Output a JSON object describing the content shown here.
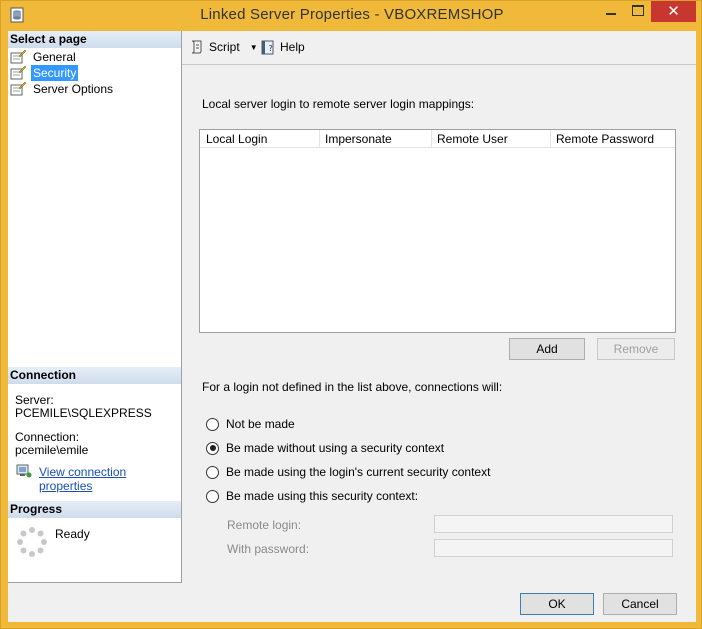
{
  "window": {
    "title": "Linked Server Properties - VBOXREMSHOP",
    "close_glyph": "✕"
  },
  "left_pane": {
    "select_page_header": "Select a page",
    "pages": [
      {
        "label": "General",
        "icon": "page-icon"
      },
      {
        "label": "Security",
        "icon": "page-icon",
        "selected": true
      },
      {
        "label": "Server Options",
        "icon": "page-icon"
      }
    ],
    "connection_header": "Connection",
    "server_label": "Server:",
    "server_value": "PCEMILE\\SQLEXPRESS",
    "connection_label": "Connection:",
    "connection_value": "pcemile\\emile",
    "view_connection_link": "View connection properties",
    "progress_header": "Progress",
    "progress_status": "Ready"
  },
  "toolbar": {
    "script_label": "Script",
    "help_label": "Help"
  },
  "security": {
    "mappings_caption": "Local server login to remote server login mappings:",
    "columns": [
      "Local Login",
      "Impersonate",
      "Remote User",
      "Remote Password"
    ],
    "rows": [],
    "add_label": "Add",
    "remove_label": "Remove",
    "not_defined_caption": "For a login not defined in the list above, connections will:",
    "options": [
      {
        "label": "Not be made",
        "checked": false
      },
      {
        "label": "Be made without using a security context",
        "checked": true
      },
      {
        "label": "Be made using the login's current security context",
        "checked": false
      },
      {
        "label": "Be made using this security context:",
        "checked": false
      }
    ],
    "remote_login_label": "Remote login:",
    "remote_login_value": "",
    "with_password_label": "With password:",
    "with_password_value": ""
  },
  "footer": {
    "ok_label": "OK",
    "cancel_label": "Cancel"
  },
  "colors": {
    "frame": "#f0b93a",
    "close_button": "#c7372f",
    "selection": "#3399ff",
    "link": "#1a4fb5"
  }
}
